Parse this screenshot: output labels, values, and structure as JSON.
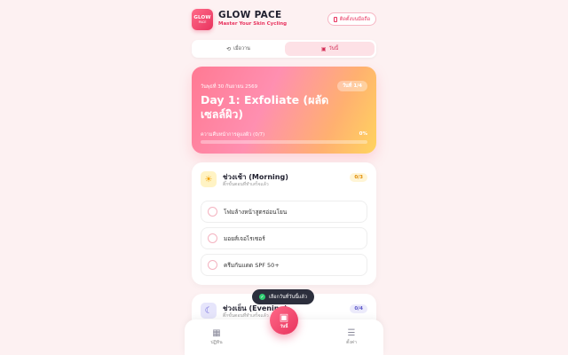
{
  "header": {
    "logo_line1": "GLOW",
    "logo_line2": "PACE",
    "app_name": "GLOW PACE",
    "tagline": "Master Your Skin Cycling",
    "install_label": "ติดตั้งบนมือถือ"
  },
  "tabs": [
    {
      "label": "เมื่อวาน",
      "icon": "undo-icon",
      "active": false
    },
    {
      "label": "วันนี้",
      "icon": "calendar-icon",
      "active": true
    }
  ],
  "hero": {
    "date": "วันพุธที่ 30 กันยายน 2569",
    "day_badge": "วันที่ 1/4",
    "title": "Day 1: Exfoliate (ผลัดเซลล์ผิว)",
    "progress_label": "ความคืบหน้าการดูแลผิว (0/7)",
    "progress_text": "0%",
    "progress_value": 0
  },
  "morning": {
    "title": "ช่วงเช้า (Morning)",
    "subtitle": "ติ๊กขั้นตอนที่ทำเสร็จแล้ว",
    "count": "0/3",
    "icon": "sun-icon",
    "items": [
      {
        "label": "โฟมล้างหน้าสูตรอ่อนโยน"
      },
      {
        "label": "มอยส์เจอไรเซอร์"
      },
      {
        "label": "ครีมกันแดด SPF 50+"
      }
    ]
  },
  "evening": {
    "title": "ช่วงเย็น (Evening)",
    "subtitle": "ติ๊กขั้นตอนที่ทำเสร็จแล้ว",
    "count": "0/4",
    "icon": "moon-icon"
  },
  "toast": {
    "text": "เลือกวันที่วันนี้แล้ว",
    "icon": "check-icon"
  },
  "bottom_nav": {
    "left_label": "ปฏิทิน",
    "center_label": "วันนี้",
    "right_label": "ตั้งค่า"
  },
  "colors": {
    "accent": "#e8335e",
    "background": "#fdf1f2"
  }
}
